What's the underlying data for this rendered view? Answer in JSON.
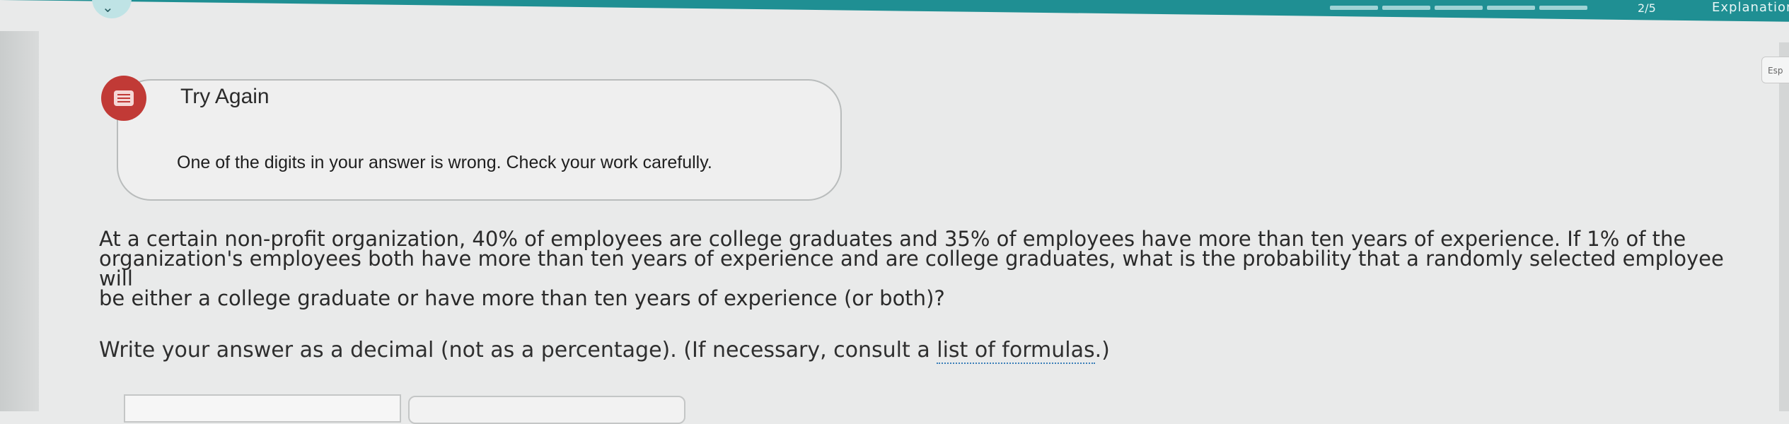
{
  "header": {
    "progress_label": "2/5",
    "brand_label": "Explanation",
    "side_tab_label": "Esp",
    "colors": {
      "bar": "#1f8f93",
      "error": "#c13a36"
    }
  },
  "feedback": {
    "icon": "alert-icon",
    "title": "Try Again",
    "message": "One of the digits in your answer is wrong. Check your work carefully."
  },
  "question": {
    "line1": "At a certain non-profit organization, 40% of employees are college graduates and 35% of employees have more than ten years of experience. If 1% of the",
    "line2": "organization's employees both have more than ten years of experience and are college graduates, what is the probability that a randomly selected employee will",
    "line3": "be either a college graduate or have more than ten years of experience (or both)?"
  },
  "instruction": {
    "before_link": "Write your answer as a decimal (not as a percentage). (If necessary, consult a ",
    "link_text": "list of formulas",
    "after_link": ".)"
  },
  "answer": {
    "value": ""
  }
}
